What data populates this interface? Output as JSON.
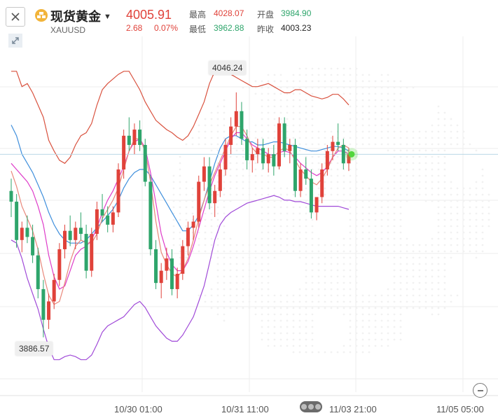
{
  "header": {
    "close_icon": "close-icon",
    "coin_icon": "gold-coin-icon",
    "title": "现货黄金",
    "dropdown_icon": "caret-down-icon",
    "symbol": "XAUUSD",
    "price": "4005.91",
    "change": "2.68",
    "change_pct": "0.07%",
    "stats": {
      "high_label": "最高",
      "high_value": "4028.07",
      "open_label": "开盘",
      "open_value": "3984.90",
      "low_label": "最低",
      "low_value": "3962.88",
      "prev_close_label": "昨收",
      "prev_close_value": "4003.23"
    }
  },
  "toolbar": {
    "expand_icon": "expand-arrows-icon",
    "zoom_out_icon": "zoom-out-icon"
  },
  "annotations": {
    "high_tag": "4046.24",
    "low_tag": "3886.57"
  },
  "x_axis": {
    "labels": [
      "10/30 01:00",
      "10/31 11:00",
      "11/03 21:00",
      "11/05 05:00"
    ]
  },
  "colors": {
    "up": "#e0423a",
    "down": "#2ea56b",
    "bollinger": "#d9523f",
    "ma_blue": "#3f8fdc",
    "ma_magenta": "#de3cc9",
    "ma_purple": "#a04ad8",
    "ma_salmon": "#e9877a",
    "live_dot": "#52d63c"
  },
  "chart_data": {
    "type": "candlestick",
    "symbol": "XAUUSD",
    "x": [
      "10/30 01:00",
      "10/31 11:00",
      "11/03 21:00",
      "11/05 05:00"
    ],
    "ylim": [
      3860,
      4080
    ],
    "annotated_high": 4046.24,
    "annotated_low": 3886.57,
    "last_price": 4005.91,
    "candles": [
      [
        3982,
        3990,
        3965,
        3975
      ],
      [
        3975,
        3980,
        3945,
        3950
      ],
      [
        3950,
        3962,
        3942,
        3958
      ],
      [
        3958,
        3966,
        3948,
        3952
      ],
      [
        3952,
        3960,
        3935,
        3940
      ],
      [
        3940,
        3945,
        3912,
        3918
      ],
      [
        3918,
        3924,
        3886.57,
        3898
      ],
      [
        3898,
        3915,
        3892,
        3910
      ],
      [
        3910,
        3928,
        3905,
        3924
      ],
      [
        3924,
        3948,
        3920,
        3944
      ],
      [
        3944,
        3960,
        3938,
        3956
      ],
      [
        3956,
        3966,
        3946,
        3950
      ],
      [
        3950,
        3962,
        3944,
        3958
      ],
      [
        3958,
        3968,
        3950,
        3954
      ],
      [
        3954,
        3960,
        3925,
        3930
      ],
      [
        3930,
        3958,
        3926,
        3954
      ],
      [
        3954,
        3975,
        3950,
        3970
      ],
      [
        3970,
        3980,
        3962,
        3966
      ],
      [
        3966,
        3972,
        3955,
        3960
      ],
      [
        3960,
        3972,
        3955,
        3968
      ],
      [
        3968,
        4000,
        3965,
        3996
      ],
      [
        3996,
        4022,
        3990,
        4018
      ],
      [
        4018,
        4030,
        4008,
        4012
      ],
      [
        4012,
        4026,
        4006,
        4022
      ],
      [
        4022,
        4028,
        4008,
        4012
      ],
      [
        4012,
        4016,
        3985,
        3988
      ],
      [
        3988,
        3992,
        3940,
        3944
      ],
      [
        3944,
        3950,
        3918,
        3922
      ],
      [
        3922,
        3935,
        3912,
        3930
      ],
      [
        3930,
        3945,
        3924,
        3938
      ],
      [
        3938,
        3944,
        3914,
        3918
      ],
      [
        3918,
        3932,
        3912,
        3928
      ],
      [
        3928,
        3950,
        3924,
        3946
      ],
      [
        3946,
        3962,
        3940,
        3958
      ],
      [
        3958,
        3966,
        3950,
        3962
      ],
      [
        3962,
        3992,
        3958,
        3988
      ],
      [
        3988,
        4004,
        3982,
        3998
      ],
      [
        3998,
        4004,
        3970,
        3974
      ],
      [
        3974,
        3986,
        3965,
        3982
      ],
      [
        3982,
        4000,
        3978,
        3996
      ],
      [
        3996,
        4016,
        3992,
        4012
      ],
      [
        4012,
        4030,
        4006,
        4024
      ],
      [
        4024,
        4046.24,
        4018,
        4034
      ],
      [
        4034,
        4040,
        4012,
        4016
      ],
      [
        4016,
        4022,
        3996,
        4002
      ],
      [
        4002,
        4010,
        3994,
        4006
      ],
      [
        4006,
        4016,
        4000,
        4010
      ],
      [
        4010,
        4016,
        3996,
        4000
      ],
      [
        4000,
        4010,
        3994,
        4006
      ],
      [
        4006,
        4012,
        3992,
        3998
      ],
      [
        3998,
        4030,
        3996,
        4026
      ],
      [
        4026,
        4030,
        4004,
        4008
      ],
      [
        4008,
        4016,
        4000,
        4012
      ],
      [
        4012,
        4016,
        3978,
        3982
      ],
      [
        3982,
        4000,
        3978,
        3996
      ],
      [
        3996,
        4004,
        3986,
        3990
      ],
      [
        3990,
        3996,
        3964,
        3968
      ],
      [
        3968,
        3972,
        3962.88,
        3978
      ],
      [
        3978,
        4000,
        3974,
        3996
      ],
      [
        3996,
        4012,
        3992,
        4008
      ],
      [
        4008,
        4018,
        4002,
        4014
      ],
      [
        4014,
        4026,
        4008,
        4012
      ],
      [
        4012,
        4016,
        3996,
        4000
      ],
      [
        4000,
        4010,
        3995,
        4005.91
      ]
    ],
    "series": [
      {
        "name": "upper",
        "values": [
          4060,
          4060,
          4050,
          4052,
          4046,
          4038,
          4030,
          4015,
          4008,
          4002,
          4000,
          4004,
          4012,
          4018,
          4020,
          4026,
          4038,
          4048,
          4052,
          4055,
          4058,
          4060,
          4060,
          4054,
          4048,
          4040,
          4034,
          4028,
          4025,
          4022,
          4020,
          4017,
          4015,
          4018,
          4024,
          4032,
          4040,
          4052,
          4060,
          4062,
          4060,
          4058,
          4056,
          4054,
          4052,
          4050,
          4050,
          4051,
          4052,
          4050,
          4048,
          4046,
          4046,
          4048,
          4048,
          4046,
          4044,
          4043,
          4042,
          4043,
          4045,
          4045,
          4042,
          4038
        ]
      },
      {
        "name": "lower",
        "values": [
          3950,
          3948,
          3938,
          3925,
          3915,
          3905,
          3892,
          3880,
          3872,
          3872,
          3874,
          3875,
          3874,
          3872,
          3872,
          3875,
          3882,
          3890,
          3894,
          3896,
          3898,
          3900,
          3904,
          3908,
          3910,
          3906,
          3900,
          3894,
          3890,
          3886,
          3884,
          3884,
          3888,
          3894,
          3900,
          3910,
          3920,
          3935,
          3950,
          3960,
          3965,
          3968,
          3970,
          3972,
          3974,
          3975,
          3976,
          3977,
          3978,
          3979,
          3978,
          3976,
          3976,
          3975,
          3975,
          3974,
          3973,
          3972,
          3972,
          3972,
          3972,
          3972,
          3971,
          3970
        ]
      },
      {
        "name": "ma-blue",
        "values": [
          4025,
          4018,
          4006,
          4000,
          3994,
          3986,
          3978,
          3968,
          3960,
          3954,
          3950,
          3948,
          3948,
          3948,
          3950,
          3954,
          3958,
          3962,
          3966,
          3970,
          3976,
          3984,
          3990,
          3994,
          3996,
          3996,
          3992,
          3986,
          3980,
          3974,
          3968,
          3962,
          3956,
          3956,
          3960,
          3966,
          3976,
          3988,
          4000,
          4010,
          4016,
          4018,
          4018,
          4016,
          4014,
          4014,
          4012,
          4012,
          4013,
          4014,
          4014,
          4013,
          4012,
          4011,
          4010,
          4009,
          4008,
          4008,
          4009,
          4010,
          4011,
          4011,
          4010,
          4008
        ]
      },
      {
        "name": "ma-magenta",
        "values": [
          4000,
          3996,
          3992,
          3988,
          3982,
          3972,
          3960,
          3940,
          3926,
          3918,
          3920,
          3930,
          3940,
          3944,
          3946,
          3950,
          3958,
          3968,
          3976,
          3982,
          3990,
          3998,
          4008,
          4014,
          4016,
          4010,
          3994,
          3974,
          3954,
          3942,
          3934,
          3930,
          3930,
          3936,
          3946,
          3958,
          3970,
          3982,
          3992,
          4000,
          4008,
          4016,
          4020,
          4020,
          4016,
          4012,
          4010,
          4008,
          4006,
          4005,
          4007,
          4008,
          4007,
          4004,
          4000,
          3997,
          3994,
          3992,
          3994,
          3998,
          4004,
          4008,
          4008,
          4006
        ]
      },
      {
        "name": "ma-salmon",
        "values": [
          3995,
          3985,
          3972,
          3964,
          3956,
          3944,
          3928,
          3914,
          3908,
          3910,
          3922,
          3936,
          3946,
          3950,
          3948,
          3948,
          3954,
          3964,
          3970,
          3976,
          3984,
          3996,
          4008,
          4016,
          4016,
          4008,
          3988,
          3962,
          3942,
          3934,
          3928,
          3926,
          3930,
          3938,
          3950,
          3964,
          3976,
          3986,
          3994,
          4002,
          4010,
          4018,
          4024,
          4024,
          4018,
          4010,
          4006,
          4006,
          4004,
          4004,
          4008,
          4010,
          4008,
          4002,
          3996,
          3992,
          3988,
          3986,
          3990,
          3996,
          4004,
          4010,
          4012,
          4010
        ]
      }
    ]
  }
}
